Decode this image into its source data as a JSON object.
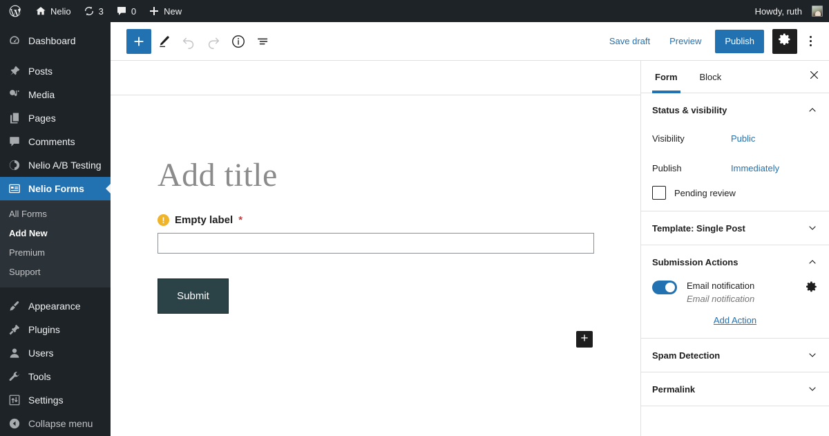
{
  "adminbar": {
    "site_name": "Nelio",
    "updates_count": "3",
    "comments_count": "0",
    "new_label": "New",
    "howdy": "Howdy, ruth",
    "icons": {
      "wordpress": "wordpress-logo-icon",
      "home": "home-icon",
      "updates": "updates-icon",
      "comments": "comment-icon",
      "plus": "plus-icon",
      "avatar": "avatar"
    }
  },
  "sidebar": {
    "items": [
      {
        "label": "Dashboard",
        "icon": "dashboard-icon",
        "current": false
      },
      {
        "label": "Posts",
        "icon": "pin-icon",
        "current": false
      },
      {
        "label": "Media",
        "icon": "media-icon",
        "current": false
      },
      {
        "label": "Pages",
        "icon": "pages-icon",
        "current": false
      },
      {
        "label": "Comments",
        "icon": "comment-icon",
        "current": false
      },
      {
        "label": "Nelio A/B Testing",
        "icon": "ab-testing-icon",
        "current": false
      },
      {
        "label": "Nelio Forms",
        "icon": "forms-icon",
        "current": true
      }
    ],
    "submenu": [
      {
        "label": "All Forms",
        "current": false
      },
      {
        "label": "Add New",
        "current": true
      },
      {
        "label": "Premium",
        "current": false
      },
      {
        "label": "Support",
        "current": false
      }
    ],
    "items_bottom": [
      {
        "label": "Appearance",
        "icon": "brush-icon"
      },
      {
        "label": "Plugins",
        "icon": "plug-icon"
      },
      {
        "label": "Users",
        "icon": "user-icon"
      },
      {
        "label": "Tools",
        "icon": "wrench-icon"
      },
      {
        "label": "Settings",
        "icon": "settings-icon"
      }
    ],
    "collapse": {
      "label": "Collapse menu",
      "icon": "collapse-arrow-icon"
    }
  },
  "toolbar": {
    "add_block": "add-block-icon",
    "tools": "pencil-icon",
    "undo": "undo-icon",
    "redo": "redo-icon",
    "details": "info-icon",
    "list_view": "list-view-icon",
    "save_draft_label": "Save draft",
    "preview_label": "Preview",
    "publish_label": "Publish",
    "settings_gear": "gear-icon",
    "more_menu": "more-options-icon"
  },
  "canvas": {
    "title_placeholder": "Add title",
    "field": {
      "label": "Empty label",
      "required_mark": "*",
      "warning_icon": "warning-icon",
      "input_value": "",
      "input_placeholder": ""
    },
    "submit_label": "Submit",
    "adder_icon": "add-block-icon"
  },
  "inspector": {
    "tabs": [
      {
        "label": "Form",
        "active": true
      },
      {
        "label": "Block",
        "active": false
      }
    ],
    "close_icon": "close-icon",
    "panels": [
      {
        "title": "Status & visibility",
        "expanded": true,
        "rows": [
          {
            "label": "Visibility",
            "value": "Public"
          },
          {
            "label": "Publish",
            "value": "Immediately"
          }
        ],
        "checkbox": {
          "label": "Pending review",
          "checked": false
        }
      },
      {
        "title": "Template: Single Post",
        "expanded": false
      },
      {
        "title": "Submission Actions",
        "expanded": true,
        "actions": [
          {
            "title": "Email notification",
            "subtitle": "Email notification",
            "enabled": true,
            "gear_icon": "gear-icon"
          }
        ],
        "add_action_label": "Add Action"
      },
      {
        "title": "Spam Detection",
        "expanded": false
      },
      {
        "title": "Permalink",
        "expanded": false
      }
    ]
  },
  "colors": {
    "admin_dark": "#1d2327",
    "admin_submenu": "#2c3338",
    "accent_blue": "#2271b1",
    "warning_orange": "#f0b429",
    "required_red": "#d63638",
    "submit_button": "#2b4247"
  }
}
